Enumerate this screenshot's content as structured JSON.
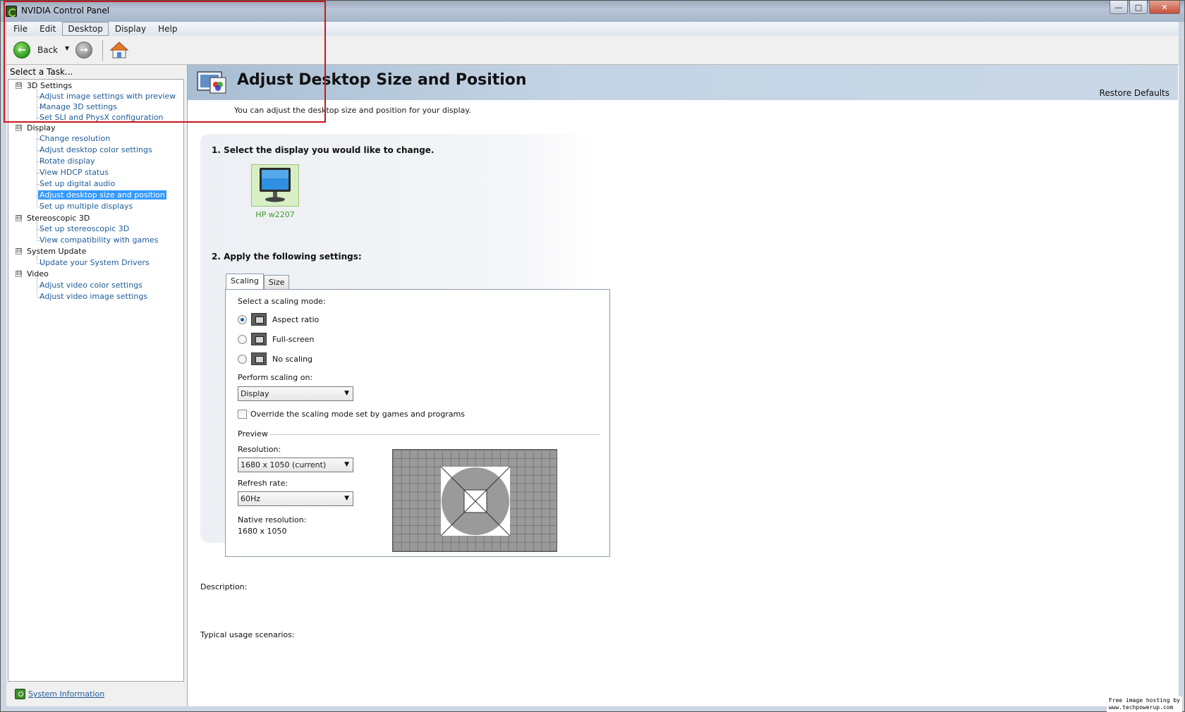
{
  "window": {
    "title": "NVIDIA Control Panel",
    "controls": {
      "minimize": "—",
      "maximize": "□",
      "close": "✕"
    }
  },
  "menubar": {
    "items": [
      "File",
      "Edit",
      "Desktop",
      "Display",
      "Help"
    ],
    "active": "Desktop"
  },
  "toolbar": {
    "back_label": "Back",
    "back_icon": "back-arrow-icon",
    "forward_icon": "forward-arrow-icon",
    "home_icon": "home-icon"
  },
  "sidebar": {
    "heading": "Select a Task...",
    "categories": [
      {
        "label": "3D Settings",
        "expander": "⊟",
        "tasks": [
          "Adjust image settings with preview",
          "Manage 3D settings",
          "Set SLI and PhysX configuration"
        ]
      },
      {
        "label": "Display",
        "expander": "⊟",
        "tasks": [
          "Change resolution",
          "Adjust desktop color settings",
          "Rotate display",
          "View HDCP status",
          "Set up digital audio",
          "Adjust desktop size and position",
          "Set up multiple displays"
        ]
      },
      {
        "label": "Stereoscopic 3D",
        "expander": "⊟",
        "tasks": [
          "Set up stereoscopic 3D",
          "View compatibility with games"
        ]
      },
      {
        "label": "System Update",
        "expander": "⊟",
        "tasks": [
          "Update your System Drivers"
        ]
      },
      {
        "label": "Video",
        "expander": "⊟",
        "tasks": [
          "Adjust video color settings",
          "Adjust video image settings"
        ]
      }
    ],
    "selected_task": "Adjust desktop size and position",
    "system_info_link": "System Information"
  },
  "main": {
    "title": "Adjust Desktop Size and Position",
    "restore_defaults": "Restore Defaults",
    "description": "You can adjust the desktop size and position for your display.",
    "step1": "1. Select the display you would like to change.",
    "display_name": "HP w2207",
    "step2": "2. Apply the following settings:",
    "tabs": [
      "Scaling",
      "Size"
    ],
    "active_tab": "Scaling",
    "scaling_mode_label": "Select a scaling mode:",
    "scaling_modes": [
      {
        "label": "Aspect ratio",
        "checked": true
      },
      {
        "label": "Full-screen",
        "checked": false
      },
      {
        "label": "No scaling",
        "checked": false
      }
    ],
    "perform_scaling_label": "Perform scaling on:",
    "perform_scaling_value": "Display",
    "override_label": "Override the scaling mode set by games and programs",
    "override_checked": false,
    "preview_label": "Preview",
    "resolution_label": "Resolution:",
    "resolution_value": "1680 x 1050 (current)",
    "refresh_label": "Refresh rate:",
    "refresh_value": "60Hz",
    "native_label": "Native resolution:",
    "native_value": "1680 x 1050",
    "description_label": "Description:",
    "typical_usage_label": "Typical usage scenarios:"
  },
  "watermark": {
    "line1": "Free image hosting by",
    "line2": "www.techpowerup.com"
  },
  "colors": {
    "selection": "#3399ff",
    "link": "#1f5b98",
    "annotation_frame": "#c8171c",
    "display_name": "#3d9a2b"
  }
}
